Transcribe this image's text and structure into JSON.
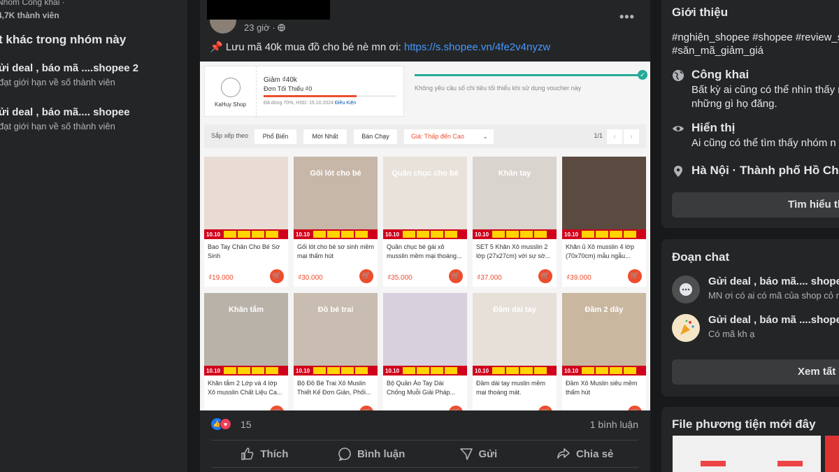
{
  "left": {
    "meta_line1": "Nhóm Công khai ·",
    "meta_line2": "4,7K thành viên",
    "other_heading": "t khác trong nhóm này",
    "groups": [
      {
        "name": "ửi deal , báo mã ....shopee 2",
        "sub": "đạt giới hạn về số thành viên"
      },
      {
        "name": "ửi deal , báo mã.... shopee",
        "sub": "đạt giới hạn về số thành viên"
      }
    ]
  },
  "post": {
    "time": "23 giờ ·",
    "text_prefix": "📌 Lưu mã 40k mua đồ cho bé nè mn ơi: ",
    "link": "https://s.shopee.vn/4fe2v4nyzw",
    "reaction_count": "15",
    "comment_count": "1 bình luận",
    "actions": [
      {
        "label": "Thích",
        "icon": "like-icon"
      },
      {
        "label": "Bình luận",
        "icon": "comment-icon"
      },
      {
        "label": "Gửi",
        "icon": "send-icon"
      },
      {
        "label": "Chia sẻ",
        "icon": "share-icon"
      }
    ]
  },
  "shopee": {
    "shop_name": "KaHuy Shop",
    "voucher_title": "Giảm ₫40k",
    "voucher_min": "Đơn Tối Thiểu ₫0",
    "voucher_used": "Đã dùng 70%, HSD: 15.10.2024",
    "voucher_terms": "Điều Kiện",
    "voucher_used_fraction": 0.7,
    "voucher_note": "Không yêu cầu số chi tiêu tối thiểu khi sử dụng voucher này",
    "sort_label": "Sắp xếp theo",
    "sort_options": [
      "Phổ Biến",
      "Mới Nhất",
      "Bán Chạy"
    ],
    "price_sort": "Giá: Thấp đến Cao",
    "page": "1/1",
    "badge_text": "10.10",
    "products": [
      {
        "title": "",
        "name": "Bao Tay Chân Cho Bé Sơ Sinh",
        "price": "₫19.000",
        "bg": "#e9dcd4"
      },
      {
        "title": "Gối lót cho bé",
        "name": "Gối lót cho bé sơ sinh mềm mại thấm hút",
        "price": "₫30.000",
        "bg": "#c7b7a8"
      },
      {
        "title": "Quần chục cho bé",
        "name": "Quần chục bé gái xô musslin mềm mại thoáng...",
        "price": "₫35.000",
        "bg": "#e8e2da"
      },
      {
        "title": "Khăn tay",
        "name": "SET 5 Khăn Xô musslin 2 lớp (27x27cm) với sự sờ...",
        "price": "₫37.000",
        "bg": "#d9d4ce"
      },
      {
        "title": "",
        "name": "Khăn ủ Xô musslin 4 lớp (70x70cm) mẫu ngẫu...",
        "price": "₫39.000",
        "bg": "#5a4a40"
      },
      {
        "title": "Khăn tắm",
        "name": "Khăn tắm 2 Lớp và 4 lớp Xô musslin Chất Liệu Ca...",
        "price": "",
        "bg": "#b9b2a8"
      },
      {
        "title": "Đồ bé trai",
        "name": "Bộ Đồ Bé Trai Xô Muslin Thiết Kế Đơn Giản, Phối...",
        "price": "",
        "bg": "#c9bcb0"
      },
      {
        "title": "",
        "name": "Bộ Quần Áo Tay Dài Chống Muỗi Giải Pháp...",
        "price": "",
        "bg": "#d8d0dc"
      },
      {
        "title": "Đầm dài tay",
        "name": "Đầm dài tay muslin mềm mại thoáng mát.",
        "price": "",
        "bg": "#e6e0d8"
      },
      {
        "title": "Đầm 2 dây",
        "name": "Đầm Xô Muslin siêu mềm thấm hút",
        "price": "",
        "bg": "#c9b7a0"
      }
    ]
  },
  "right": {
    "about_title": "Giới thiệu",
    "hashtags_1": "#nghiện_shopee #shopee #review_s",
    "hashtags_2": "#săn_mã_giảm_giá",
    "public_title": "Công khai",
    "public_desc_1": "Bất kỳ ai cũng có thể nhìn thấy m",
    "public_desc_2": "những gì họ đăng.",
    "visible_title": "Hiển thị",
    "visible_desc": "Ai cũng có thể tìm thấy nhóm n",
    "location": "Hà Nội · Thành phố Hồ Chí",
    "learn_more": "Tìm hiểu th",
    "chat_title": "Đoạn chat",
    "chats": [
      {
        "name": "Gửi deal , báo mã.... shopee",
        "msg": "MN ơi có ai có mã của shop cỏ m"
      },
      {
        "name": "Gửi deal , báo mã ....shopee",
        "msg": "Có mã kh ạ"
      }
    ],
    "see_all": "Xem tất c",
    "media_title": "File phương tiện mới đây"
  }
}
